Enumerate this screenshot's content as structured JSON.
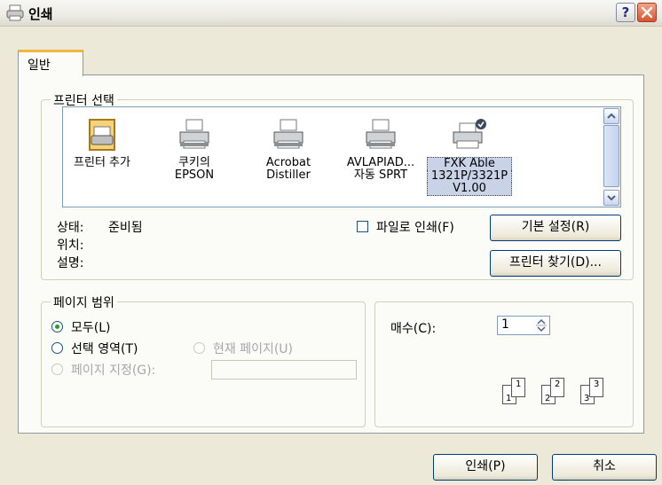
{
  "window": {
    "title": "인쇄",
    "help_label": "?"
  },
  "tabs": [
    {
      "label": "일반"
    }
  ],
  "printer_select": {
    "legend": "프린터 선택",
    "printers": [
      {
        "line1": "프린터 추가",
        "line2": "",
        "line3": ""
      },
      {
        "line1": "쿠키의",
        "line2": "EPSON",
        "line3": ""
      },
      {
        "line1": "Acrobat",
        "line2": "Distiller",
        "line3": ""
      },
      {
        "line1": "AVLAPIAD...",
        "line2": "자동 SPRT",
        "line3": ""
      },
      {
        "line1": "FXK Able",
        "line2": "1321P/3321P",
        "line3": "V1.00"
      }
    ],
    "status_label": "상태:",
    "status_value": "준비됨",
    "location_label": "위치:",
    "comment_label": "설명:",
    "print_to_file_label": "파일로 인쇄(F)",
    "preferences_button": "기본 설정(R)",
    "find_printer_button": "프린터 찾기(D)..."
  },
  "page_range": {
    "legend": "페이지 범위",
    "all_label": "모두(L)",
    "selection_label": "선택 영역(T)",
    "current_page_label": "현재 페이지(U)",
    "pages_label": "페이지 지정(G):",
    "pages_value": ""
  },
  "copies": {
    "label": "매수(C):",
    "value": "1",
    "collate_pages": [
      "1",
      "1",
      "2",
      "2",
      "3",
      "3"
    ]
  },
  "footer": {
    "print_button": "인쇄(P)",
    "cancel_button": "취소"
  },
  "colors": {
    "window_bg": "#ece9d8",
    "panel_bg": "#fbfbf8",
    "tab_accent": "#f2b63c",
    "selection": "#c8d3e8"
  }
}
